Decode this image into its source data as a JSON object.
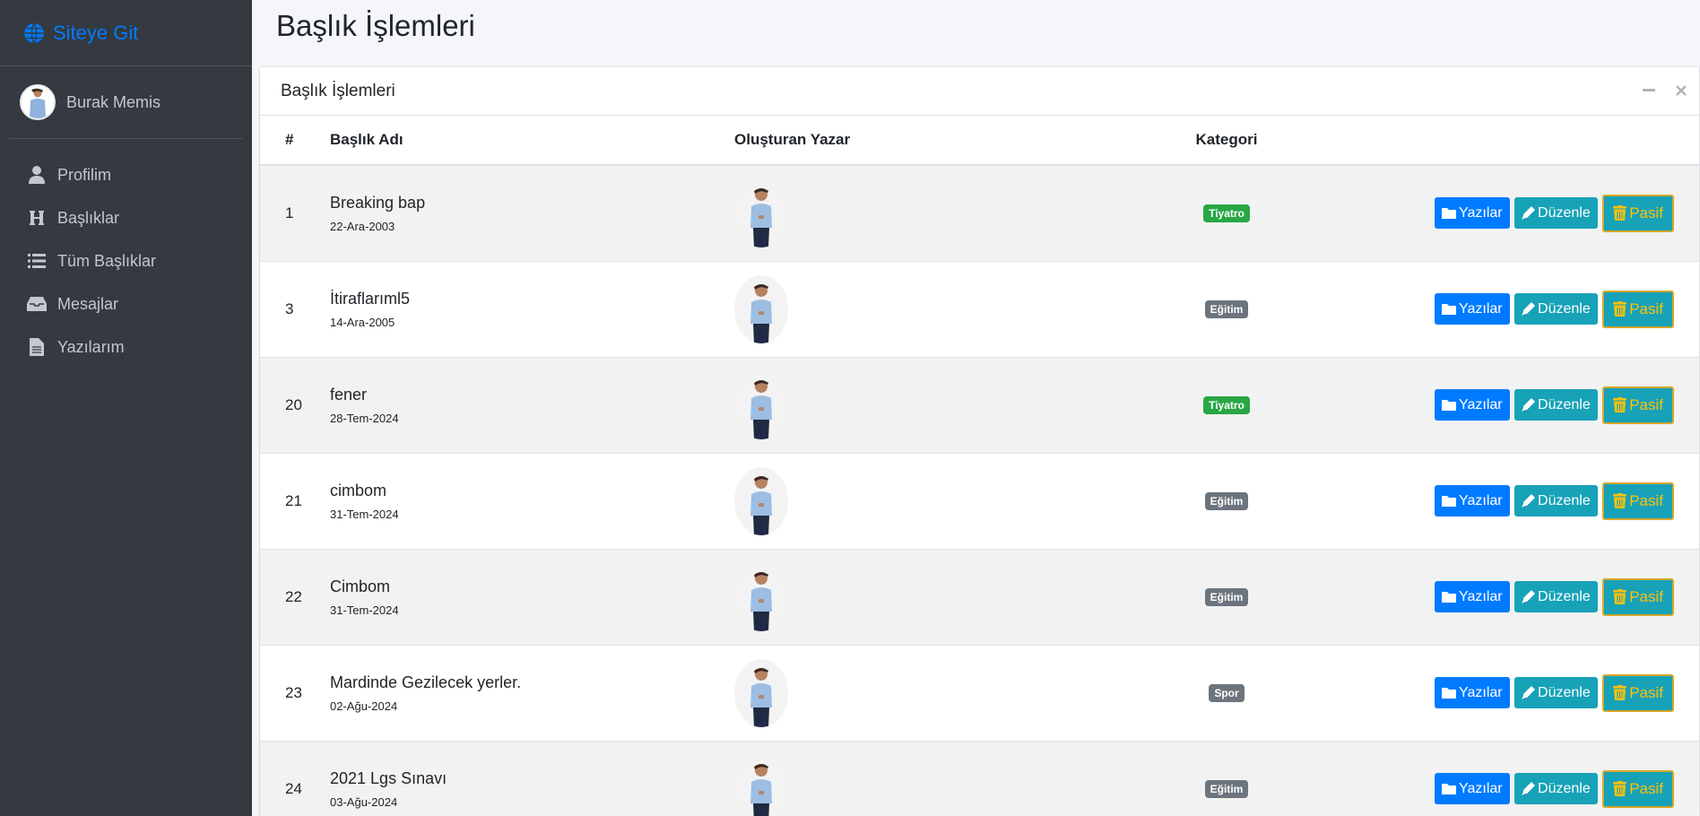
{
  "brand": {
    "label": "Siteye Git",
    "icon": "globe-icon",
    "color": "#007bff"
  },
  "user": {
    "name": "Burak Memis"
  },
  "nav": [
    {
      "label": "Profilim",
      "icon": "user-icon"
    },
    {
      "label": "Başlıklar",
      "icon": "heading-icon"
    },
    {
      "label": "Tüm Başlıklar",
      "icon": "list-icon"
    },
    {
      "label": "Mesajlar",
      "icon": "inbox-icon"
    },
    {
      "label": "Yazılarım",
      "icon": "file-icon"
    }
  ],
  "page": {
    "title": "Başlık İşlemleri"
  },
  "card": {
    "title": "Başlık İşlemleri"
  },
  "table": {
    "headers": [
      "#",
      "Başlık Adı",
      "Oluşturan Yazar",
      "Kategori"
    ],
    "actions": {
      "posts": "Yazılar",
      "edit": "Düzenle",
      "passive": "Pasif"
    },
    "rows": [
      {
        "id": "1",
        "title": "Breaking bap",
        "date": "22-Ara-2003",
        "category": "Tiyatro",
        "category_color": "#28a745"
      },
      {
        "id": "3",
        "title": "İtiraflarıml5",
        "date": "14-Ara-2005",
        "category": "Eğitim",
        "category_color": "#6c757d"
      },
      {
        "id": "20",
        "title": "fener",
        "date": "28-Tem-2024",
        "category": "Tiyatro",
        "category_color": "#28a745"
      },
      {
        "id": "21",
        "title": "cimbom",
        "date": "31-Tem-2024",
        "category": "Eğitim",
        "category_color": "#6c757d"
      },
      {
        "id": "22",
        "title": "Cimbom",
        "date": "31-Tem-2024",
        "category": "Eğitim",
        "category_color": "#6c757d"
      },
      {
        "id": "23",
        "title": "Mardinde Gezilecek yerler.",
        "date": "02-Ağu-2024",
        "category": "Spor",
        "category_color": "#6c757d"
      },
      {
        "id": "24",
        "title": "2021 Lgs Sınavı",
        "date": "03-Ağu-2024",
        "category": "Eğitim",
        "category_color": "#6c757d"
      }
    ]
  }
}
